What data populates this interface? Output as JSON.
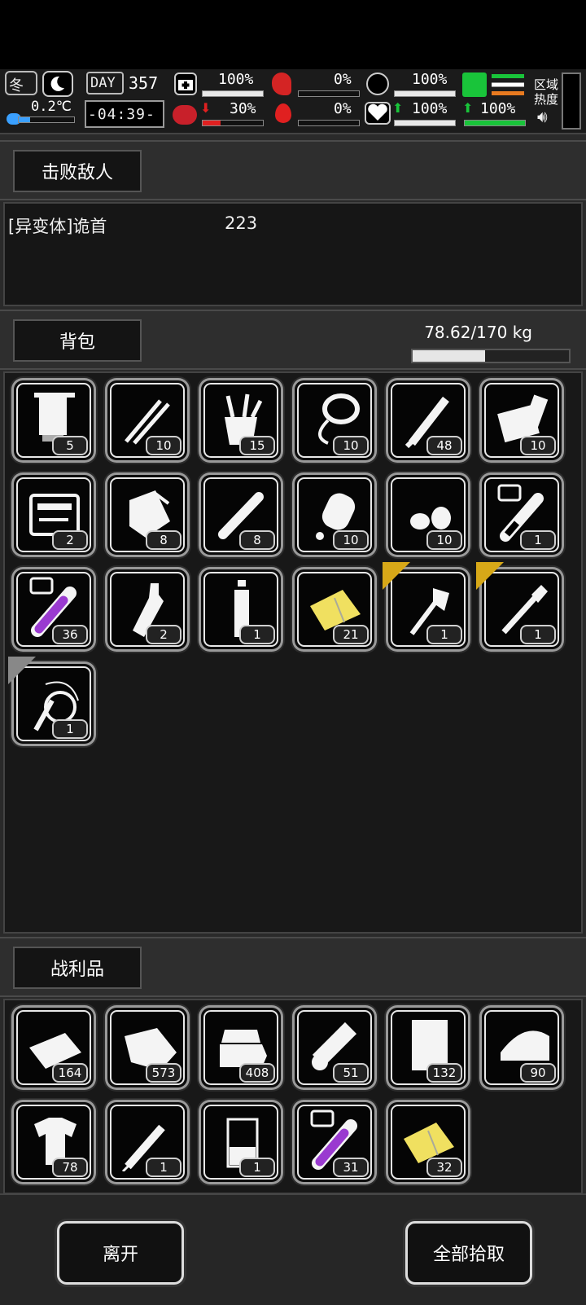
{
  "hud": {
    "season": "冬",
    "temperature": "0.2℃",
    "day_label": "DAY",
    "day_number": "357",
    "clock": "-04:39-",
    "health_pct": "100%",
    "health_fill": 1.0,
    "brain_pct": "30%",
    "brain_fill": 0.3,
    "stomach_pct": "0%",
    "stomach_fill": 0.0,
    "blood_pct": "0%",
    "blood_fill": 0.0,
    "pill_pct": "100%",
    "pill_fill": 1.0,
    "heart_pct": "100%",
    "heart_fill": 1.0,
    "stamina_pct": "100%",
    "stamina_fill": 1.0,
    "zone_label_1": "区域",
    "zone_label_2": "热度"
  },
  "defeated": {
    "header": "击败敌人",
    "enemy_name": "[异变体]诡首",
    "enemy_count": "223"
  },
  "backpack": {
    "header": "背包",
    "weight": "78.62/170 kg",
    "weight_fraction": 0.4625,
    "items": [
      {
        "icon": "towel-icon",
        "count": "5"
      },
      {
        "icon": "tweezers-icon",
        "count": "10"
      },
      {
        "icon": "tool-bucket-icon",
        "count": "15"
      },
      {
        "icon": "rope-icon",
        "count": "10"
      },
      {
        "icon": "brush-icon",
        "count": "48"
      },
      {
        "icon": "paper-roll-icon",
        "count": "10"
      },
      {
        "icon": "toolkit-icon",
        "count": "2"
      },
      {
        "icon": "supplies-bag-icon",
        "count": "8"
      },
      {
        "icon": "cigarette-icon",
        "count": "8"
      },
      {
        "icon": "glue-bottle-icon",
        "count": "10"
      },
      {
        "icon": "seeds-icon",
        "count": "10"
      },
      {
        "icon": "test-tube-i-icon",
        "count": "1"
      },
      {
        "icon": "purple-test-tube-icon",
        "count": "36"
      },
      {
        "icon": "flask-bottle-icon",
        "count": "2"
      },
      {
        "icon": "water-bottle-icon",
        "count": "1"
      },
      {
        "icon": "yellow-cloth-icon",
        "count": "21"
      },
      {
        "icon": "axe-icon",
        "count": "1"
      },
      {
        "icon": "shovel-icon",
        "count": "1"
      },
      {
        "icon": "whip-icon",
        "count": "1"
      }
    ]
  },
  "loot": {
    "header": "战利品",
    "items": [
      {
        "icon": "cloth-sheet-icon",
        "count": "164"
      },
      {
        "icon": "leather-hide-icon",
        "count": "573"
      },
      {
        "icon": "folded-cloth-icon",
        "count": "408"
      },
      {
        "icon": "bandage-roll-icon",
        "count": "51"
      },
      {
        "icon": "paper-bag-icon",
        "count": "132"
      },
      {
        "icon": "fabric-fold-icon",
        "count": "90"
      },
      {
        "icon": "torn-shirt-icon",
        "count": "78"
      },
      {
        "icon": "syringe-icon",
        "count": "1"
      },
      {
        "icon": "beaker-icon",
        "count": "1"
      },
      {
        "icon": "purple-test-tube-icon",
        "count": "31"
      },
      {
        "icon": "yellow-cloth-icon",
        "count": "32"
      }
    ]
  },
  "actions": {
    "leave": "离开",
    "take_all": "全部拾取"
  },
  "colors": {
    "health_bar": "#e8e8e8",
    "brain_bar": "#e02020",
    "stamina_bar": "#19c43a",
    "badge_gold": "#d7a818",
    "purple_liquid": "#9a3ad0",
    "yellow_cloth": "#f0e060"
  }
}
